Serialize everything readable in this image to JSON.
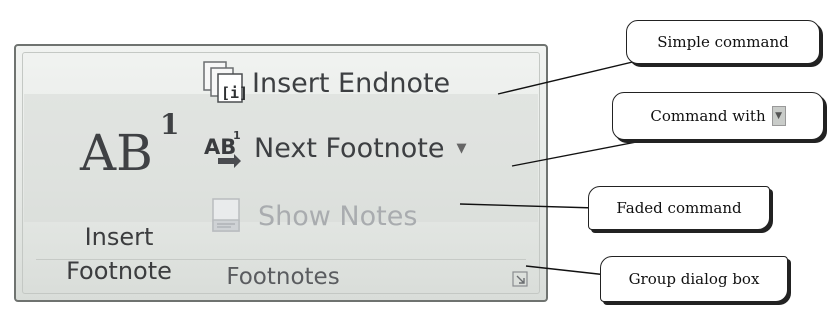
{
  "ribbon_group": {
    "name": "Footnotes",
    "big_button": {
      "icon_text": "AB",
      "icon_superscript": "1",
      "label_line1": "Insert",
      "label_line2": "Footnote"
    },
    "commands": [
      {
        "label": "Insert Endnote",
        "icon": "insert-endnote-icon",
        "state": "enabled"
      },
      {
        "label": "Next Footnote",
        "icon": "next-footnote-icon",
        "state": "enabled",
        "has_dropdown": true
      },
      {
        "label": "Show Notes",
        "icon": "show-notes-icon",
        "state": "disabled"
      }
    ],
    "dialog_launcher_icon": "dialog-launcher-icon"
  },
  "callouts": {
    "simple": "Simple command",
    "dropdown": "Command with",
    "faded": "Faded command",
    "dialog": "Group dialog box"
  },
  "colors": {
    "panel_top": "#f1f3f1",
    "panel_bottom": "#d9ddd9",
    "text": "#3d3f42",
    "faded_text": "#a9acaf"
  }
}
